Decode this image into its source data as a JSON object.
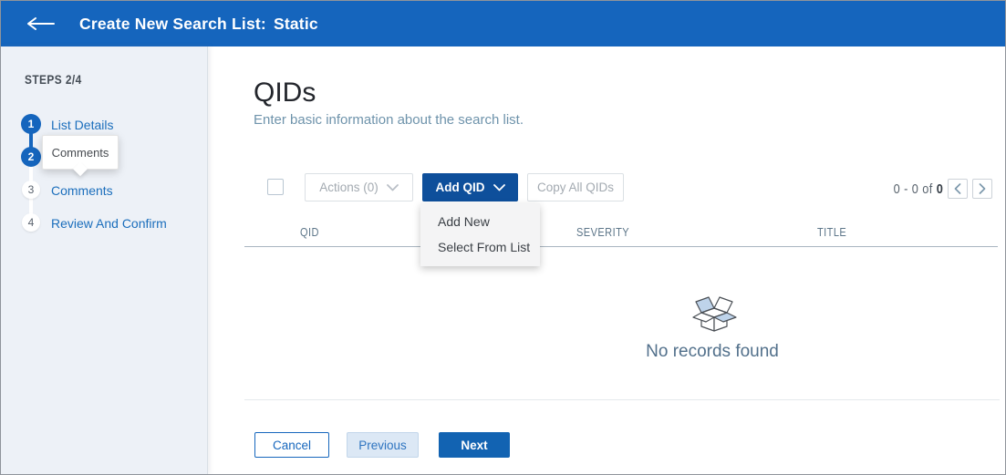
{
  "header": {
    "title": "Create New Search List:",
    "title_bold": "Static"
  },
  "sidebar": {
    "steps_label": "STEPS 2/4",
    "tooltip_text": "Comments",
    "steps": [
      {
        "num": "1",
        "label": "List Details"
      },
      {
        "num": "2",
        "label": ""
      },
      {
        "num": "3",
        "label": "Comments"
      },
      {
        "num": "4",
        "label": "Review And Confirm"
      }
    ]
  },
  "main": {
    "title": "QIDs",
    "subtitle": "Enter basic information about the search list.",
    "toolbar": {
      "actions_label": "Actions (0)",
      "add_qid_label": "Add QID",
      "copy_label": "Copy All QIDs"
    },
    "dropdown": {
      "items": [
        "Add New",
        "Select From List"
      ]
    },
    "pagination": {
      "range": "0 - 0 of",
      "total": "0"
    },
    "table": {
      "columns": [
        "QID",
        "SEVERITY",
        "TITLE"
      ]
    },
    "empty_message": "No records found",
    "footer": {
      "cancel": "Cancel",
      "previous": "Previous",
      "next": "Next"
    }
  },
  "icons": {
    "back": "back-arrow-icon",
    "dropdown_chevron": "chevron-down-icon",
    "page_prev": "chevron-left-icon",
    "page_next": "chevron-right-icon",
    "empty_state": "open-box-icon"
  },
  "colors": {
    "header_blue": "#1565bd",
    "primary_button_blue": "#0e4f9b",
    "next_button_blue": "#1263b2",
    "link_blue": "#1b6ebc",
    "sidebar_bg": "#edf1f7",
    "muted_slate": "#5d7689",
    "disabled_text": "#a3aab1",
    "empty_text": "#52708b"
  }
}
